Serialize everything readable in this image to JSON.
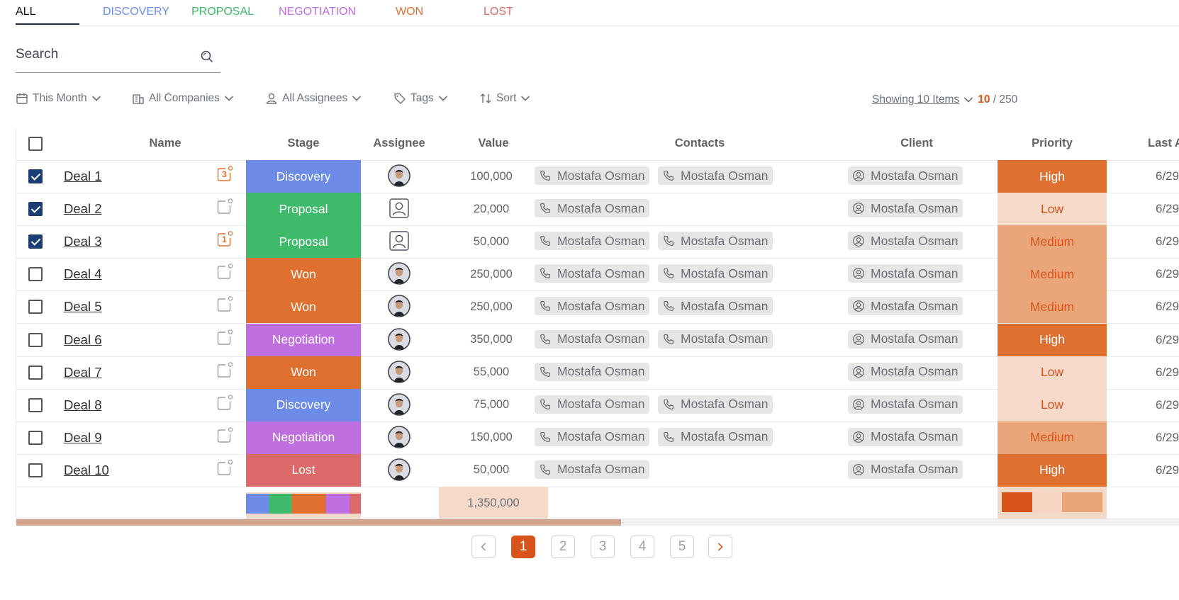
{
  "tabs": [
    {
      "label": "ALL",
      "color": "#111111",
      "active": true
    },
    {
      "label": "DISCOVERY",
      "color": "#6c8ce8"
    },
    {
      "label": "PROPOSAL",
      "color": "#3dba6a"
    },
    {
      "label": "NEGOTIATION",
      "color": "#c06fe0"
    },
    {
      "label": "WON",
      "color": "#e07030"
    },
    {
      "label": "LOST",
      "color": "#dc6a6a"
    }
  ],
  "search": {
    "label": "Search",
    "placeholder": "",
    "icon": "search-icon"
  },
  "filters": [
    {
      "label": "This Month",
      "icon": "calendar-icon"
    },
    {
      "label": "All Companies",
      "icon": "building-icon"
    },
    {
      "label": "All Assignees",
      "icon": "user-icon"
    },
    {
      "label": "Tags",
      "icon": "tag-icon"
    },
    {
      "label": "Sort",
      "icon": "sort-icon"
    }
  ],
  "showing": {
    "label": "Showing 10 Items",
    "current": "10",
    "total": "/ 250"
  },
  "columns": {
    "name": "Name",
    "stage": "Stage",
    "assignee": "Assignee",
    "value": "Value",
    "contacts": "Contacts",
    "client": "Client",
    "priority": "Priority",
    "last": "Last A"
  },
  "stage_colors": {
    "Discovery": "#6c8ce8",
    "Proposal": "#3dba6a",
    "Won": "#e07030",
    "Negotiation": "#c06fe0",
    "Lost": "#dc6a6a"
  },
  "priority_styles": {
    "High": {
      "bg": "#e07030",
      "fg": "#ffffff"
    },
    "Medium": {
      "bg": "#eba57b",
      "fg": "#d9541a"
    },
    "Low": {
      "bg": "#f5dac9",
      "fg": "#d9541a"
    }
  },
  "deals": [
    {
      "name": "Deal 1",
      "checked": true,
      "tasks": "3",
      "stage": "Discovery",
      "assignee": "photo",
      "value": "100,000",
      "contacts": [
        "Mostafa Osman",
        "Mostafa Osman"
      ],
      "client": "Mostafa Osman",
      "priority": "High",
      "last": "6/29"
    },
    {
      "name": "Deal 2",
      "checked": true,
      "tasks": "",
      "stage": "Proposal",
      "assignee": "placeholder",
      "value": "20,000",
      "contacts": [
        "Mostafa Osman"
      ],
      "client": "Mostafa Osman",
      "priority": "Low",
      "last": "6/29"
    },
    {
      "name": "Deal 3",
      "checked": true,
      "tasks": "1",
      "stage": "Proposal",
      "assignee": "placeholder",
      "value": "50,000",
      "contacts": [
        "Mostafa Osman",
        "Mostafa Osman"
      ],
      "client": "Mostafa Osman",
      "priority": "Medium",
      "last": "6/29"
    },
    {
      "name": "Deal 4",
      "checked": false,
      "tasks": "",
      "stage": "Won",
      "assignee": "photo",
      "value": "250,000",
      "contacts": [
        "Mostafa Osman",
        "Mostafa Osman"
      ],
      "client": "Mostafa Osman",
      "priority": "Medium",
      "last": "6/29"
    },
    {
      "name": "Deal 5",
      "checked": false,
      "tasks": "",
      "stage": "Won",
      "assignee": "photo",
      "value": "250,000",
      "contacts": [
        "Mostafa Osman",
        "Mostafa Osman"
      ],
      "client": "Mostafa Osman",
      "priority": "Medium",
      "last": "6/29"
    },
    {
      "name": "Deal 6",
      "checked": false,
      "tasks": "",
      "stage": "Negotiation",
      "assignee": "photo",
      "value": "350,000",
      "contacts": [
        "Mostafa Osman",
        "Mostafa Osman"
      ],
      "client": "Mostafa Osman",
      "priority": "High",
      "last": "6/29"
    },
    {
      "name": "Deal 7",
      "checked": false,
      "tasks": "",
      "stage": "Won",
      "assignee": "photo",
      "value": "55,000",
      "contacts": [
        "Mostafa Osman"
      ],
      "client": "Mostafa Osman",
      "priority": "Low",
      "last": "6/29"
    },
    {
      "name": "Deal 8",
      "checked": false,
      "tasks": "",
      "stage": "Discovery",
      "assignee": "photo",
      "value": "75,000",
      "contacts": [
        "Mostafa Osman",
        "Mostafa Osman"
      ],
      "client": "Mostafa Osman",
      "priority": "Low",
      "last": "6/29"
    },
    {
      "name": "Deal 9",
      "checked": false,
      "tasks": "",
      "stage": "Negotiation",
      "assignee": "photo",
      "value": "150,000",
      "contacts": [
        "Mostafa Osman",
        "Mostafa Osman"
      ],
      "client": "Mostafa Osman",
      "priority": "Medium",
      "last": "6/29"
    },
    {
      "name": "Deal 10",
      "checked": false,
      "tasks": "",
      "stage": "Lost",
      "assignee": "photo",
      "value": "50,000",
      "contacts": [
        "Mostafa Osman"
      ],
      "client": "Mostafa Osman",
      "priority": "High",
      "last": "6/29"
    }
  ],
  "totals": {
    "value": "1,350,000",
    "stage_breakdown": [
      {
        "stage": "Discovery",
        "count": 2
      },
      {
        "stage": "Proposal",
        "count": 2
      },
      {
        "stage": "Won",
        "count": 3
      },
      {
        "stage": "Negotiation",
        "count": 2
      },
      {
        "stage": "Lost",
        "count": 1
      }
    ],
    "priority_breakdown": [
      {
        "priority": "High",
        "count": 3,
        "color": "#d9541a"
      },
      {
        "priority": "Low",
        "count": 3,
        "color": "#f5d4c2"
      },
      {
        "priority": "Medium",
        "count": 4,
        "color": "#eba57b"
      }
    ]
  },
  "scroll_fraction": 0.52,
  "pagination": {
    "pages": [
      "1",
      "2",
      "3",
      "4",
      "5"
    ],
    "active": "1",
    "prev_icon": "chevron-left-icon",
    "next_icon": "chevron-right-icon"
  }
}
